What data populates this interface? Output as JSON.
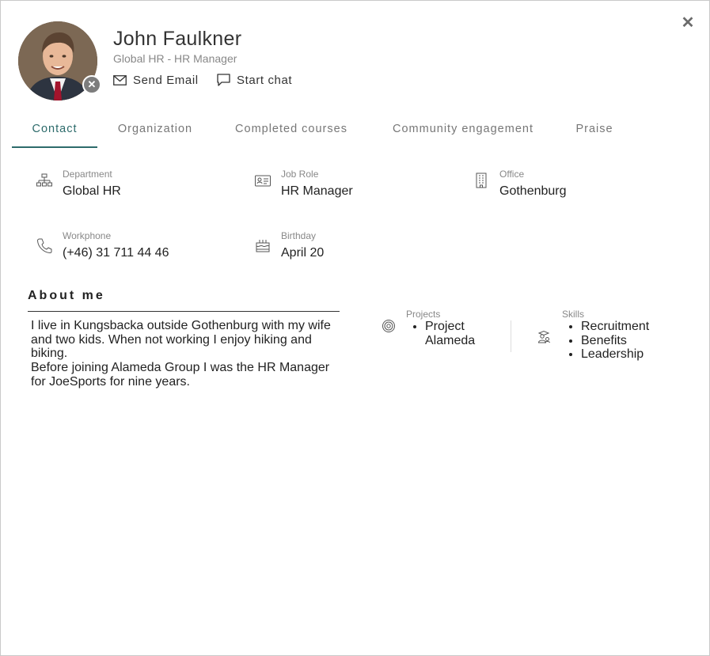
{
  "close_icon": "close-icon",
  "profile": {
    "name": "John Faulkner",
    "subtitle": "Global HR - HR Manager",
    "presence_icon": "x-icon"
  },
  "actions": {
    "send_email": "Send Email",
    "start_chat": "Start chat"
  },
  "tabs": [
    {
      "label": "Contact",
      "active": true
    },
    {
      "label": "Organization",
      "active": false
    },
    {
      "label": "Completed courses",
      "active": false
    },
    {
      "label": "Community engagement",
      "active": false
    },
    {
      "label": "Praise",
      "active": false
    }
  ],
  "fields": {
    "department": {
      "label": "Department",
      "value": "Global HR",
      "icon": "org-chart-icon"
    },
    "job_role": {
      "label": "Job Role",
      "value": "HR Manager",
      "icon": "id-card-icon"
    },
    "office": {
      "label": "Office",
      "value": "Gothenburg",
      "icon": "building-icon"
    },
    "workphone": {
      "label": "Workphone",
      "value": "(+46) 31 711 44 46",
      "icon": "phone-icon"
    },
    "birthday": {
      "label": "Birthday",
      "value": "April 20",
      "icon": "cake-icon"
    }
  },
  "about": {
    "title": "About me",
    "line1": "I live in Kungsbacka outside Gothenburg with my wife and two kids. When not working I enjoy hiking and biking.",
    "line2": "Before joining Alameda Group I was the HR Manager for JoeSports for nine years."
  },
  "projects": {
    "label": "Projects",
    "icon": "target-icon",
    "items": [
      "Project Alameda"
    ]
  },
  "skills": {
    "label": "Skills",
    "icon": "graduate-icon",
    "items": [
      "Recruitment",
      "Benefits",
      "Leadership"
    ]
  }
}
